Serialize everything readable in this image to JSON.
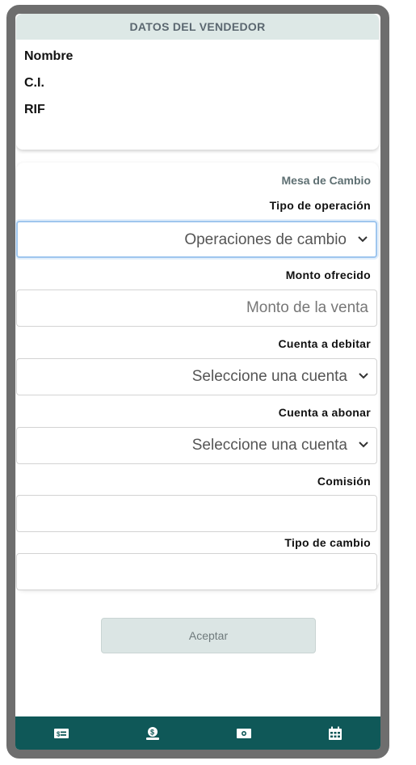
{
  "seller": {
    "header": "DATOS DEL VENDEDOR",
    "fields": [
      "Nombre",
      "C.I.",
      "RIF"
    ]
  },
  "form": {
    "section_title": "Mesa de Cambio",
    "operation_type": {
      "label": "Tipo de operación",
      "value": "Operaciones de cambio"
    },
    "amount": {
      "label": "Monto ofrecido",
      "placeholder": "Monto de la venta"
    },
    "debit_account": {
      "label": "Cuenta a debitar",
      "value": "Seleccione una cuenta"
    },
    "credit_account": {
      "label": "Cuenta a abonar",
      "value": "Seleccione una cuenta"
    },
    "commission": {
      "label": "Comisión",
      "value": ""
    },
    "exchange_rate": {
      "label": "Tipo de cambio",
      "value": ""
    }
  },
  "actions": {
    "accept_label": "Aceptar"
  },
  "bottom_nav": {
    "items": [
      "money-bill-icon",
      "hand-coin-icon",
      "cash-icon",
      "calendar-icon"
    ]
  },
  "colors": {
    "frame": "#6e6e6e",
    "header_bg": "#dde8e6",
    "nav_bg": "#0f5858",
    "button_bg": "#dbe5e4",
    "focus_border": "#9fc6ee"
  }
}
